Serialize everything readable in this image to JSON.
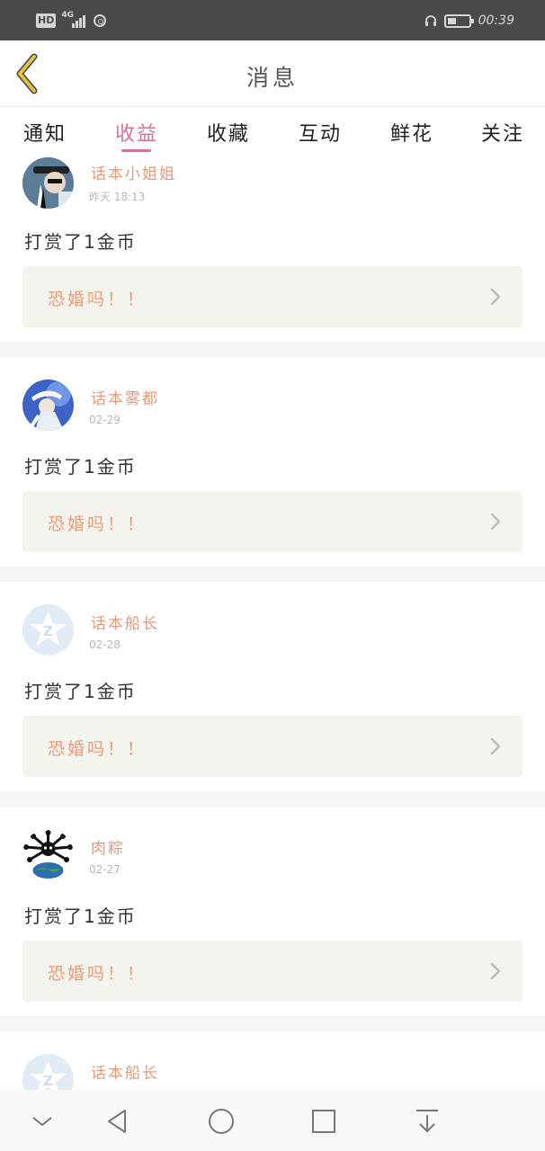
{
  "status_bar": {
    "hd": "HD",
    "network": "4G",
    "time": "00:39"
  },
  "header": {
    "title": "消息",
    "back_icon": "chevron-left-icon"
  },
  "tabs": [
    {
      "label": "通知"
    },
    {
      "label": "收益",
      "active": true
    },
    {
      "label": "收藏"
    },
    {
      "label": "互动"
    },
    {
      "label": "鲜花"
    },
    {
      "label": "关注"
    }
  ],
  "feed": [
    {
      "name": "话本小姐姐",
      "date": "昨天 18:13",
      "action": "打赏了1金币",
      "quote": "恐婚吗！！",
      "avatar": "photo-avatar"
    },
    {
      "name": "话本雾都",
      "date": "02-29",
      "action": "打赏了1金币",
      "quote": "恐婚吗！！",
      "avatar": "photo-avatar"
    },
    {
      "name": "话本船长",
      "date": "02-28",
      "action": "打赏了1金币",
      "quote": "恐婚吗！！",
      "avatar": "default-star-avatar"
    },
    {
      "name": "肉粽",
      "date": "02-27",
      "action": "打赏了1金币",
      "quote": "恐婚吗！！",
      "avatar": "cartoon-avatar"
    },
    {
      "name": "话本船长",
      "avatar": "default-star-avatar"
    }
  ],
  "colors": {
    "accent": "#d4739a",
    "username": "#e39a7a",
    "quote_text": "#ef9a75",
    "quote_bg": "#f4f4ee",
    "back_icon": "#e0c340"
  },
  "nav_bar": [
    "chevron-down-icon",
    "back-triangle-icon",
    "home-circle-icon",
    "recents-square-icon",
    "download-icon"
  ]
}
